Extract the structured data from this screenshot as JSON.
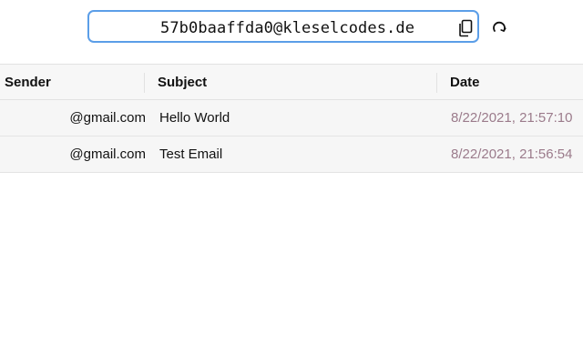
{
  "address": {
    "email": "57b0baaffda0@kleselcodes.de"
  },
  "table": {
    "headers": {
      "sender": "Sender",
      "subject": "Subject",
      "date": "Date"
    },
    "rows": [
      {
        "sender": "@gmail.com",
        "subject": "Hello World",
        "date": "8/22/2021, 21:57:10"
      },
      {
        "sender": "@gmail.com",
        "subject": "Test Email",
        "date": "8/22/2021, 21:56:54"
      }
    ]
  },
  "colors": {
    "accent_border": "#5b9ee8",
    "date_text": "#9b7b8b",
    "row_background": "#f6f6f6"
  },
  "icons": {
    "copy": "copy-icon",
    "refresh": "refresh-icon"
  }
}
